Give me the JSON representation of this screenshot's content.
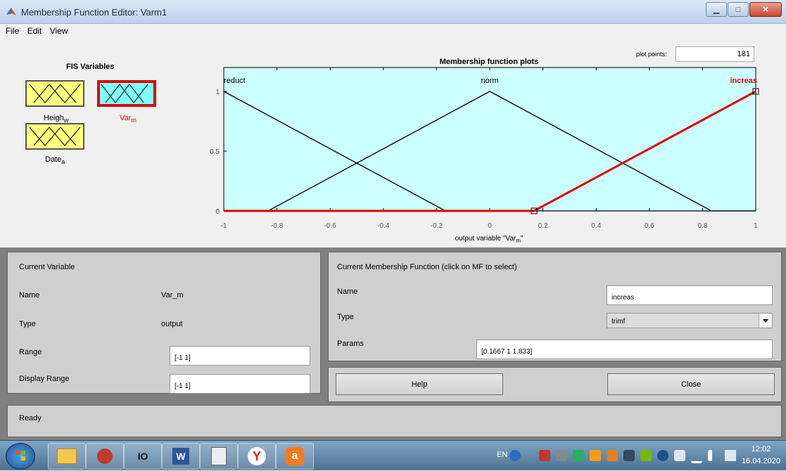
{
  "window": {
    "title": "Membership Function Editor: Varm1"
  },
  "menu": [
    "File",
    "Edit",
    "View"
  ],
  "fis": {
    "title": "FIS Variables",
    "variables": [
      {
        "label": "Heigh",
        "sub": "w",
        "selected": false
      },
      {
        "label": "Var",
        "sub": "m",
        "selected": true
      },
      {
        "label": "Date",
        "sub": "a",
        "selected": false
      }
    ]
  },
  "plot_points": {
    "label": "plot points:",
    "value": "181"
  },
  "chart_data": {
    "type": "line",
    "title": "Membership function plots",
    "xlabel": "output variable \"Var_m\"",
    "xlabel_main": "output variable \"Var",
    "xlabel_sub": "m",
    "xlabel_end": "\"",
    "xlim": [
      -1,
      1
    ],
    "ylim": [
      0,
      1
    ],
    "xticks": [
      "-1",
      "-0.8",
      "-0.6",
      "-0.4",
      "-0.2",
      "0",
      "0.2",
      "0.4",
      "0.6",
      "0.8",
      "1"
    ],
    "yticks": [
      "0",
      "0.5",
      "1"
    ],
    "series": [
      {
        "name": "reduct",
        "type": "trimf",
        "points": [
          [
            -1.8333,
            0
          ],
          [
            -1,
            1
          ],
          [
            -0.1667,
            0
          ]
        ],
        "selected": false
      },
      {
        "name": "norm",
        "type": "trimf",
        "points": [
          [
            -0.8333,
            0
          ],
          [
            0,
            1
          ],
          [
            0.8333,
            0
          ]
        ],
        "selected": false
      },
      {
        "name": "increas",
        "type": "trimf",
        "points": [
          [
            0.1667,
            0
          ],
          [
            1,
            1
          ],
          [
            1.833,
            0
          ]
        ],
        "selected": true
      }
    ],
    "colors": {
      "background": "#ccffff",
      "line": "#000000",
      "selected": "#e00000"
    }
  },
  "current_variable": {
    "title": "Current Variable",
    "name_label": "Name",
    "name_value": "Var_m",
    "type_label": "Type",
    "type_value": "output",
    "range_label": "Range",
    "range_value": "[-1 1]",
    "display_range_label": "Display Range",
    "display_range_value": "[-1 1]"
  },
  "current_mf": {
    "title": "Current Membership Function (click on MF to select)",
    "name_label": "Name",
    "name_value": "increas",
    "type_label": "Type",
    "type_value": "trimf",
    "params_label": "Params",
    "params_value": "[0.1667 1 1.833]"
  },
  "buttons": {
    "help": "Help",
    "close": "Close"
  },
  "status": "Ready",
  "taskbar": {
    "lang": "EN",
    "time": "12:02",
    "date": "16.04.2020"
  }
}
